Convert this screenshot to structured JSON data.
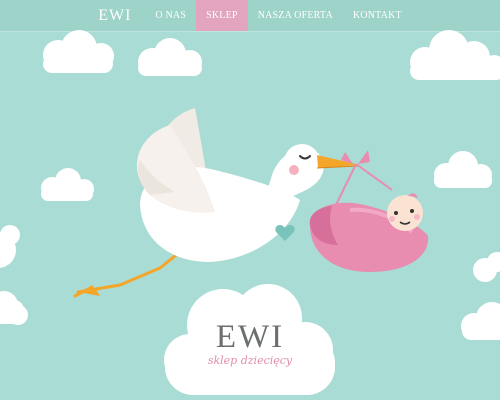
{
  "nav": {
    "brand": "EWI",
    "items": [
      {
        "label": "O NAS"
      },
      {
        "label": "SKLEP"
      },
      {
        "label": "NASZA OFERTA"
      },
      {
        "label": "KONTAKT"
      }
    ],
    "active_item": "SKLEP"
  },
  "hero": {
    "title": "EWI",
    "subtitle": "sklep dziecięcy"
  },
  "colors": {
    "background": "#a9dcd4",
    "nav_bar": "#9ed3ca",
    "active_nav": "#e2a4be",
    "stork_white": "#ffffff",
    "beak_orange": "#f4a62a",
    "bundle_pink": "#e88cb0",
    "title_grey": "#6b6f6e",
    "subtitle_pink": "#e28bac"
  },
  "icons": [
    "stork-illustration",
    "baby-bundle-illustration",
    "heart-icon",
    "cloud-shapes"
  ]
}
